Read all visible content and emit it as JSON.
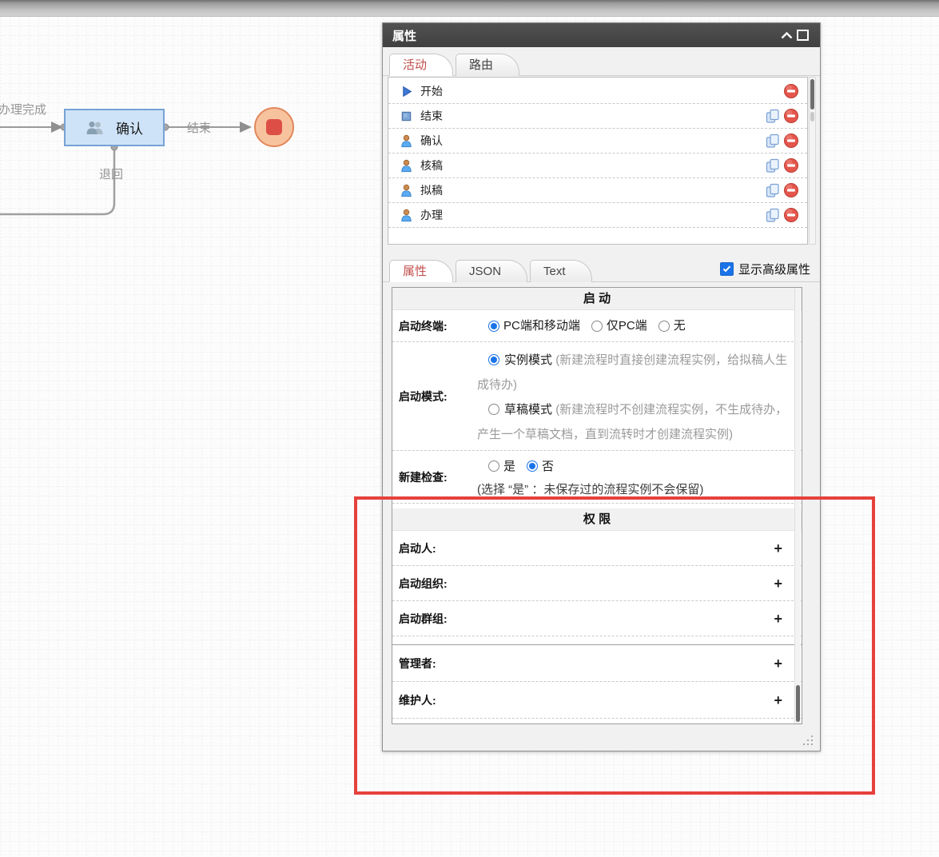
{
  "canvas": {
    "labels": {
      "done": "办理完成",
      "end": "结束",
      "back": "退回"
    },
    "confirm_node": {
      "label": "确认"
    }
  },
  "panel": {
    "title": "属性",
    "top_tabs": [
      {
        "label": "活动",
        "active": true
      },
      {
        "label": "路由",
        "active": false
      }
    ],
    "activities": [
      {
        "label": "开始",
        "icon": "play-icon",
        "copyable": false
      },
      {
        "label": "结束",
        "icon": "stop-square-icon",
        "copyable": true
      },
      {
        "label": "确认",
        "icon": "person-icon",
        "copyable": true
      },
      {
        "label": "核稿",
        "icon": "person-icon",
        "copyable": true
      },
      {
        "label": "拟稿",
        "icon": "person-icon",
        "copyable": true
      },
      {
        "label": "办理",
        "icon": "person-icon",
        "copyable": true
      }
    ],
    "sub_tabs": [
      {
        "label": "属性",
        "active": true
      },
      {
        "label": "JSON",
        "active": false
      },
      {
        "label": "Text",
        "active": false
      }
    ],
    "advanced_checkbox": {
      "label": "显示高级属性",
      "checked": true
    },
    "form": {
      "start_section": {
        "title": "启 动",
        "terminal": {
          "label": "启动终端:",
          "options": [
            {
              "label": "PC端和移动端",
              "selected": true
            },
            {
              "label": "仅PC端",
              "selected": false
            },
            {
              "label": "无",
              "selected": false
            }
          ]
        },
        "mode": {
          "label": "启动模式:",
          "options": [
            {
              "label": "实例模式",
              "selected": true,
              "note": "(新建流程时直接创建流程实例，给拟稿人生成待办)"
            },
            {
              "label": "草稿模式",
              "selected": false,
              "note": "(新建流程时不创建流程实例，不生成待办，产生一个草稿文档，直到流转时才创建流程实例)"
            }
          ]
        },
        "newcheck": {
          "label": "新建检查:",
          "options": [
            {
              "label": "是",
              "selected": false
            },
            {
              "label": "否",
              "selected": true
            }
          ],
          "note": "(选择 “是” ：未保存过的流程实例不会保留)"
        }
      },
      "perm_section": {
        "title": "权 限",
        "rows": [
          {
            "label": "启动人:",
            "add": "+"
          },
          {
            "label": "启动组织:",
            "add": "+"
          },
          {
            "label": "启动群组:",
            "add": "+"
          }
        ],
        "rows2": [
          {
            "label": "管理者:",
            "add": "+"
          },
          {
            "label": "维护人:",
            "add": "+"
          }
        ]
      }
    }
  },
  "colors": {
    "tab_active_text": "#c0504d",
    "annotation_red": "#e6413c",
    "checkbox_blue": "#1a73e8",
    "node_fill": "#cfe3f8",
    "node_border": "#76a3d6",
    "end_fill": "#f7c39e",
    "end_border": "#e2875c",
    "end_core": "#dd4f46"
  }
}
